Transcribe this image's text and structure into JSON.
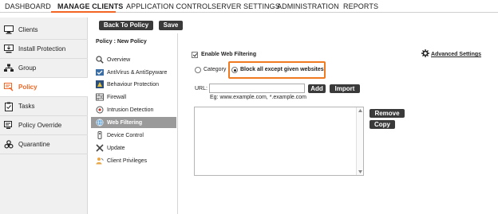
{
  "nav": {
    "tabs": [
      {
        "label": "DASHBOARD"
      },
      {
        "label": "MANAGE CLIENTS"
      },
      {
        "label": "APPLICATION CONTROL"
      },
      {
        "label": "SERVER SETTINGS"
      },
      {
        "label": "ADMINISTRATION"
      },
      {
        "label": "REPORTS"
      }
    ],
    "active": "MANAGE CLIENTS",
    "accent_color": "#f26522"
  },
  "sidebar": {
    "items": [
      {
        "label": "Clients",
        "icon": "monitor-icon"
      },
      {
        "label": "Install Protection",
        "icon": "install-monitor-icon"
      },
      {
        "label": "Group",
        "icon": "group-icon"
      },
      {
        "label": "Policy",
        "icon": "policy-icon"
      },
      {
        "label": "Tasks",
        "icon": "tasks-icon"
      },
      {
        "label": "Policy Override",
        "icon": "policy-override-icon"
      },
      {
        "label": "Quarantine",
        "icon": "biohazard-icon"
      }
    ],
    "active": "Policy"
  },
  "toolbar": {
    "back_label": "Back To Policy",
    "save_label": "Save"
  },
  "policy": {
    "title": "Policy : New Policy",
    "tree": [
      {
        "label": "Overview",
        "icon": "magnifier-icon"
      },
      {
        "label": "AntiVirus & AntiSpyware",
        "icon": "antivirus-icon"
      },
      {
        "label": "Behaviour Protection",
        "icon": "behaviour-icon"
      },
      {
        "label": "Firewall",
        "icon": "firewall-icon"
      },
      {
        "label": "Intrusion Detection",
        "icon": "intrusion-icon"
      },
      {
        "label": "Web Filtering",
        "icon": "globe-icon"
      },
      {
        "label": "Device Control",
        "icon": "device-icon"
      },
      {
        "label": "Update",
        "icon": "update-icon"
      },
      {
        "label": "Client Privileges",
        "icon": "privileges-icon"
      }
    ],
    "active": "Web Filtering"
  },
  "web_filtering": {
    "enable_label": "Enable Web Filtering",
    "enable_checked": true,
    "advanced_label": "Advanced Settings",
    "mode_category": "Category",
    "mode_block_all": "Block all except given websites",
    "selected_mode": "block_all",
    "url_label": "URL:",
    "url_value": "",
    "url_example": "Eg: www.example.com, *.example.com",
    "add_label": "Add",
    "import_label": "Import",
    "remove_label": "Remove",
    "copy_label": "Copy"
  }
}
